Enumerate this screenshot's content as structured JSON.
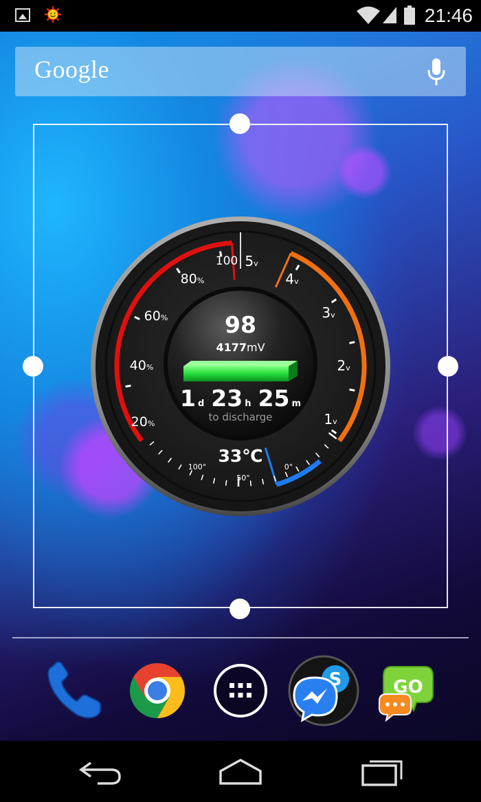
{
  "status_bar": {
    "time": "21:46",
    "icons": [
      "gallery-icon",
      "sun-smile-icon",
      "wifi-icon",
      "cell-signal-icon",
      "battery-icon"
    ]
  },
  "search": {
    "logo_text": "Google",
    "icon": "mic-icon"
  },
  "widget": {
    "percent": "98",
    "voltage_value": "4177",
    "voltage_unit": "mV",
    "time_days": "1",
    "time_days_unit": "d",
    "time_hours": "23",
    "time_hours_unit": "h",
    "time_minutes": "25",
    "time_minutes_unit": "m",
    "status_text": "to discharge",
    "temperature": "33℃",
    "percent_scale": [
      {
        "value": "20",
        "unit": "%"
      },
      {
        "value": "40",
        "unit": "%"
      },
      {
        "value": "60",
        "unit": "%"
      },
      {
        "value": "80",
        "unit": "%"
      },
      {
        "value": "100",
        "unit": ""
      }
    ],
    "voltage_scale": [
      {
        "value": "1",
        "unit": "v"
      },
      {
        "value": "2",
        "unit": "v"
      },
      {
        "value": "3",
        "unit": "v"
      },
      {
        "value": "4",
        "unit": "v"
      },
      {
        "value": "5",
        "unit": "v"
      }
    ],
    "temp_scale": [
      "100°",
      "50°",
      "0°"
    ],
    "colors": {
      "percent_arc": "#e01010",
      "voltage_arc": "#f07010",
      "temp_arc": "#1e7af0",
      "battery_fill": "#22dd3a"
    }
  },
  "dock": {
    "items": [
      {
        "name": "phone-icon"
      },
      {
        "name": "chrome-icon"
      },
      {
        "name": "app-drawer-icon"
      },
      {
        "name": "messenger-skype-folder-icon"
      },
      {
        "name": "go-sms-icon"
      }
    ]
  },
  "nav": {
    "buttons": [
      "back-icon",
      "home-icon",
      "recents-icon"
    ]
  }
}
